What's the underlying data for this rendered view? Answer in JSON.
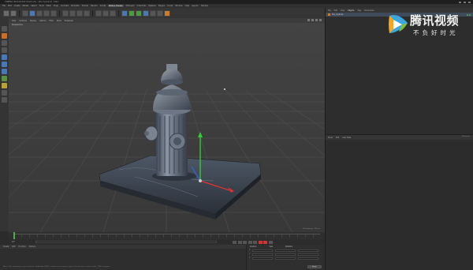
{
  "window": {
    "title": "CINEMA 4D R19.024 Studio (R) - [fire hydrant] - Main"
  },
  "menu": {
    "items": [
      "File",
      "Edit",
      "Create",
      "Modes",
      "Select",
      "Tools",
      "Mesh",
      "Snap",
      "Animate",
      "Simulate",
      "Tracker",
      "Render",
      "Sculpt",
      "Motion Tracker",
      "MoGraph",
      "Character",
      "Pipeline",
      "Plugins",
      "Script",
      "Window",
      "Help",
      "Layout:",
      "Startup"
    ],
    "highlight_index": 13
  },
  "viewport": {
    "menu": [
      "View",
      "Cameras",
      "Display",
      "Options",
      "Filter",
      "Panel",
      "ProRender"
    ],
    "label": "Perspective",
    "corner_text": "Grid Spacing : 100 cm"
  },
  "timeline": {
    "frame": "0 F",
    "current_frame": 0
  },
  "materials": {
    "tabs": [
      "Create",
      "Edit",
      "Function",
      "Texture"
    ],
    "status": "Move: Click and drag to move elements. Hold down SHIFT to quantize movement / add to the selection in point mode, CTRL to remove."
  },
  "coords": {
    "headers": [
      "Position",
      "Size",
      "Rotation"
    ],
    "rows": [
      "X",
      "Y",
      "Z"
    ],
    "apply_label": "Apply"
  },
  "object_manager": {
    "tabs": [
      "File",
      "Edit",
      "View",
      "Objects",
      "Tags",
      "Bookmarks"
    ],
    "active_tab": "Objects",
    "items": [
      {
        "name": "fire_hydrant"
      }
    ]
  },
  "attribute_manager": {
    "tabs": [
      "Mode",
      "Edit",
      "User Data"
    ],
    "mode_label": "Attributes"
  },
  "watermark": {
    "title": "腾讯视频",
    "subtitle": "不负好时光"
  },
  "colors": {
    "background": "#3a3a3a",
    "accent_green": "#4cae4c",
    "accent_blue": "#4a78b5",
    "accent_orange": "#c87b2a",
    "axis_x": "#d33",
    "axis_y": "#3c3",
    "axis_z": "#36c"
  }
}
